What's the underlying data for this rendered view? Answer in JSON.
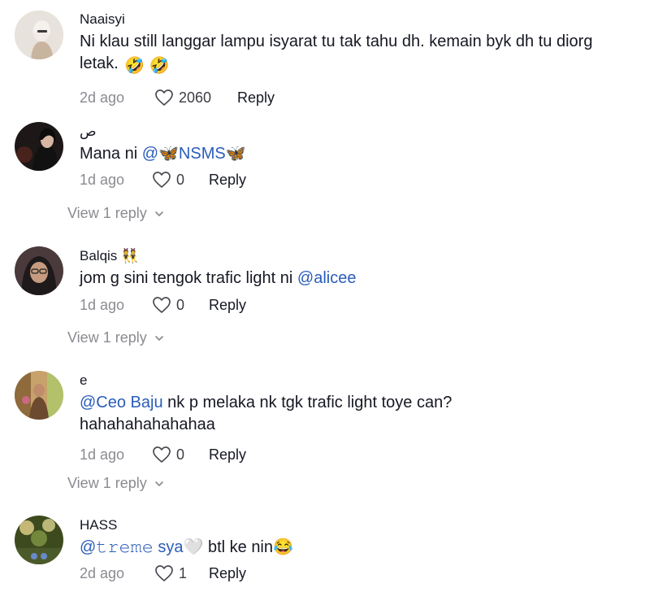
{
  "comments": [
    {
      "username": "Naaisyi",
      "text": "Ni klau still langgar lampu isyarat tu tak tahu dh. kemain byk dh tu diorg letak.",
      "emojis": "🤣 🤣",
      "time": "2d ago",
      "likes": "2060",
      "reply_label": "Reply"
    },
    {
      "username": "ص",
      "text_prefix": "Mana ni",
      "mention": "@🦋NSMS🦋",
      "time": "1d ago",
      "likes": "0",
      "reply_label": "Reply",
      "view_replies": "View 1 reply"
    },
    {
      "username": "Balqis",
      "username_badge": "👯",
      "text_prefix": "jom g sini tengok trafic light ni",
      "mention": "@alicee",
      "time": "1d ago",
      "likes": "0",
      "reply_label": "Reply",
      "view_replies": "View 1 reply"
    },
    {
      "username": "e",
      "mention": "@Ceo Baju",
      "text_suffix": "nk p melaka nk tgk trafic light toye can? hahahahahahahaa",
      "time": "1d ago",
      "likes": "0",
      "reply_label": "Reply",
      "view_replies": "View 1 reply"
    },
    {
      "username": "HASS",
      "mention": "@𝚝𝚛𝚎𝚖𝚎 sya🤍",
      "text_suffix": "btl ke nin😂",
      "time": "2d ago",
      "likes": "1",
      "reply_label": "Reply"
    }
  ],
  "colors": {
    "mention": "#2b5db9",
    "secondary_text": "#8a8b91",
    "primary_text": "#161823"
  },
  "icons": {
    "like": "heart-outline-icon",
    "expand": "chevron-down-icon"
  }
}
